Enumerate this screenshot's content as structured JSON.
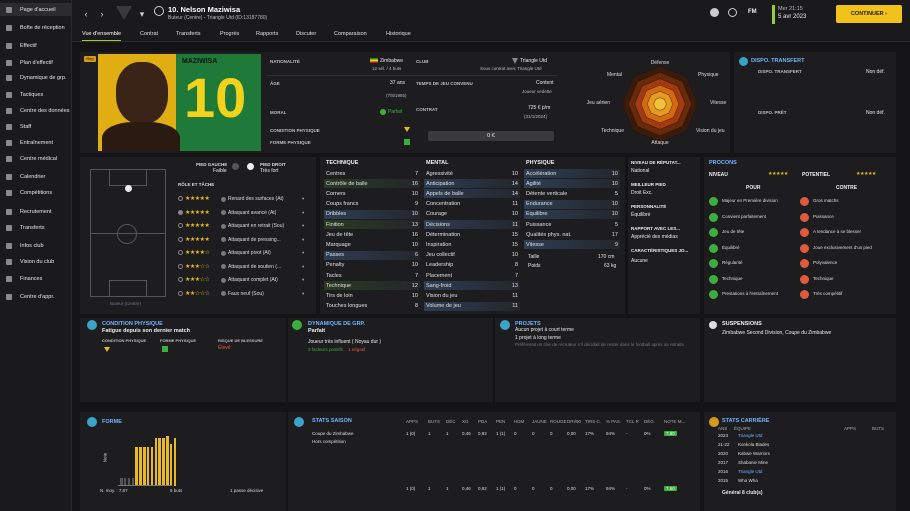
{
  "sidebar": [
    {
      "label": "Page d'accueil"
    },
    {
      "label": "Boîte de réception"
    },
    {
      "label": "Effectif"
    },
    {
      "label": "Plan d'effectif"
    },
    {
      "label": "Dynamique de grp."
    },
    {
      "label": "Tactiques"
    },
    {
      "label": "Centre des données"
    },
    {
      "label": "Staff"
    },
    {
      "label": "Entraînement"
    },
    {
      "label": "Centre médical"
    },
    {
      "label": "Calendrier"
    },
    {
      "label": "Compétitions"
    },
    {
      "label": "Recrutement"
    },
    {
      "label": "Transferts"
    },
    {
      "label": "Infos club"
    },
    {
      "label": "Vision du club"
    },
    {
      "label": "Finances"
    },
    {
      "label": "Centre d'appr."
    }
  ],
  "header": {
    "player": "10. Nelson Maziwisa",
    "subtitle": "Buteur (Centre) - Triangle Utd (ID:13187780)",
    "time": "Mer 21:15",
    "date": "5 avr 2023",
    "continue": "CONTINUER",
    "fm": "FM"
  },
  "tabs": [
    "Vue d'ensemble",
    "Contrat",
    "Transferts",
    "Progrès",
    "Rapports",
    "Discuter",
    "Comparaison",
    "Historique"
  ],
  "profile": {
    "shirt_name": "MAZIWISA",
    "shirt_number": "10",
    "badge": "Rep",
    "nationality_label": "NATIONALITÉ",
    "nationality": "Zimbabwe",
    "caps": "12 sél. / 4 buts",
    "club_label": "CLUB",
    "club": "Triangle Utd",
    "club_contract": "Sous contrat avec Triangle Utd",
    "age_label": "ÂGE",
    "age": "37 ans",
    "dob": "(7/8/1985)",
    "playtime_label": "TEMPS DE JEU CONVENU",
    "playtime": "Content",
    "playtime_role": "Joueur vedette",
    "contract_label": "CONTRAT",
    "wage": "725 € p/m",
    "contract_end": "(31/1/2024)",
    "morale_label": "MORAL",
    "morale": "Parfait",
    "condition_label": "CONDITION PHYSIQUE",
    "form_label": "FORME PHYSIQUE",
    "value": "0 €"
  },
  "radar": {
    "labels": [
      "Défense",
      "Physique",
      "Vitesse",
      "Vision du jeu",
      "Attaque",
      "Technique",
      "Jeu aérien",
      "Mental"
    ]
  },
  "transfer": {
    "title": "DISPO. TRANSFERT",
    "r1_label": "DISPO. TRANSFERT",
    "r1": "Non déf.",
    "r2_label": "DISPO. PRÊT",
    "r2": "Non déf."
  },
  "positions": {
    "foot_left_label": "PIED GAUCHE",
    "foot_left": "Faible",
    "foot_right_label": "PIED DROIT",
    "foot_right": "Très fort",
    "pitch_caption": "Buteur (Centre)",
    "role_title": "RÔLE ET TÂCHE",
    "roles": [
      {
        "name": "Renard des surfaces (At)",
        "stars": "★★★★★"
      },
      {
        "name": "Attaquant avancé (At)",
        "stars": "★★★★★"
      },
      {
        "name": "Attaquant en retrait (Sou)",
        "stars": "★★★★★"
      },
      {
        "name": "Attaquant de pressing...",
        "stars": "★★★★★"
      },
      {
        "name": "Attaquant pivot (At)",
        "stars": "★★★★☆"
      },
      {
        "name": "Attaquant de soutien (...",
        "stars": "★★★☆☆"
      },
      {
        "name": "Attaquant complet (At)",
        "stars": "★★★☆☆"
      },
      {
        "name": "Faux neuf (Sou)",
        "stars": "★★☆☆☆"
      }
    ]
  },
  "technique": {
    "title": "TECHNIQUE",
    "rows": [
      [
        "Centres",
        "7",
        ""
      ],
      [
        "Contrôle de balle",
        "16",
        "gr"
      ],
      [
        "Corners",
        "10",
        ""
      ],
      [
        "Coups francs",
        "9",
        ""
      ],
      [
        "Dribbles",
        "10",
        "hl"
      ],
      [
        "Finition",
        "13",
        "gr"
      ],
      [
        "Jeu de tête",
        "16",
        ""
      ],
      [
        "Marquage",
        "10",
        ""
      ],
      [
        "Passes",
        "6",
        "hl"
      ],
      [
        "Penalty",
        "10",
        ""
      ],
      [
        "Tacles",
        "7",
        ""
      ],
      [
        "Technique",
        "12",
        "gr"
      ],
      [
        "Tirs de loin",
        "10",
        ""
      ],
      [
        "Touches longues",
        "8",
        ""
      ]
    ]
  },
  "mental": {
    "title": "MENTAL",
    "rows": [
      [
        "Agressivité",
        "10",
        ""
      ],
      [
        "Anticipation",
        "14",
        "hl"
      ],
      [
        "Appels de balle",
        "14",
        "hl"
      ],
      [
        "Concentration",
        "11",
        ""
      ],
      [
        "Courage",
        "10",
        ""
      ],
      [
        "Décisions",
        "11",
        "hl"
      ],
      [
        "Détermination",
        "15",
        ""
      ],
      [
        "Inspiration",
        "15",
        ""
      ],
      [
        "Jeu collectif",
        "10",
        ""
      ],
      [
        "Leadership",
        "8",
        ""
      ],
      [
        "Placement",
        "7",
        ""
      ],
      [
        "Sang-froid",
        "13",
        "hl"
      ],
      [
        "Vision du jeu",
        "11",
        ""
      ],
      [
        "Volume de jeu",
        "11",
        "hl"
      ]
    ]
  },
  "physique": {
    "title": "PHYSIQUE",
    "rows": [
      [
        "Accélération",
        "10",
        "hl"
      ],
      [
        "Agilité",
        "10",
        "hl"
      ],
      [
        "Détente verticale",
        "5",
        ""
      ],
      [
        "Endurance",
        "10",
        "hl"
      ],
      [
        "Equilibre",
        "10",
        "hl"
      ],
      [
        "Puissance",
        "5",
        ""
      ],
      [
        "Qualités phys. nat.",
        "17",
        ""
      ],
      [
        "Vitesse",
        "9",
        "hl"
      ]
    ],
    "height_label": "Taille",
    "height": "170 cm",
    "weight_label": "Poids",
    "weight": "63 kg"
  },
  "info": {
    "rep_label": "NIVEAU DE RÉPUTAT...",
    "rep": "National",
    "foot_label": "MEILLEUR PIED",
    "foot": "Droit Exc.",
    "pers_label": "PERSONNALITÉ",
    "pers": "Équilibré",
    "media_label": "RAPPORT AVEC LES...",
    "media": "Apprécié des médias",
    "char_label": "CARACTÉRISTIQUES JO...",
    "char": "Aucune"
  },
  "procons": {
    "title": "PROCONS",
    "level": "NIVEAU",
    "potential": "POTENTIEL",
    "pour": "POUR",
    "contre": "CONTRE",
    "level_stars": "★★★★★",
    "pot_stars": "★★★★★",
    "pros": [
      "Majeur en Première division",
      "Convient parfaitement",
      "Jeu de tête",
      "Équilibré",
      "Régularité",
      "Technique",
      "Prestations à l'entraînement"
    ],
    "cons": [
      "Gros matchs",
      "Puissance",
      "A tendance à se blesser",
      "Joue exclusivement d'un pied",
      "Polyvalence",
      "Technique",
      "Très compétitif"
    ]
  },
  "condition": {
    "title": "CONDITION PHYSIQUE",
    "text": "Fatigue depuis son dernier match",
    "c1": "CONDITION PHYSIQUE",
    "c2": "FORME PHYSIQUE",
    "c3": "RISQUE DE BLESSURE",
    "risk": "Élevé"
  },
  "dynamics": {
    "title": "DYNAMIQUE DE GRP.",
    "state": "Parfait",
    "role": "Joueur très influent ( Noyau dur )",
    "pos": "3 facteurs positifs",
    "neg": "1 négatif"
  },
  "projects": {
    "title": "PROJETS",
    "p1": "Aucun projet à court terme",
    "p2": "1 projet à long terme",
    "p3": "Préférerait un rôle de recruteur s'il décidait de rester dans le football après sa retraite"
  },
  "susp": {
    "title": "SUSPENSIONS",
    "text": "Zimbabwe Second Division, Coupe du Zimbabwe"
  },
  "form": {
    "title": "FORME",
    "ylabel": "Note",
    "avg": "N. moy. : 7,67",
    "goals": "5 buts",
    "assist": "1 passe décisive",
    "bars": [
      0.15,
      0.15,
      0.15,
      0.15,
      0.7,
      0.7,
      0.7,
      0.7,
      0.7,
      0.85,
      0.85,
      0.85,
      0.9,
      0.75,
      0.85
    ]
  },
  "season": {
    "title": "STATS SAISON",
    "cols": [
      "APPS",
      "BUTS",
      "DÉC",
      "XG",
      "PDA",
      "PEN",
      "HDM",
      "JAUNE",
      "ROUGE",
      "DRI/90",
      "TIRS C.",
      "% PAS.",
      "TCL R",
      "DÉG.",
      "NOTE M..."
    ],
    "rows": [
      {
        "name": "Coupe du Zimbabwe",
        "vals": [
          "1 (0)",
          "1",
          "1",
          "0,46",
          "0,92",
          "1 (1)",
          "0",
          "0",
          "0",
          "0,00",
          "17%",
          "94%",
          "-",
          "0%",
          "7,60"
        ]
      },
      {
        "name": "Hors compétition",
        "vals": [
          "",
          "",
          "",
          "",
          "",
          "",
          "",
          "",
          "",
          "",
          "",
          "",
          "",
          "",
          ""
        ]
      },
      {
        "name": "",
        "vals": [
          "1 (0)",
          "1",
          "1",
          "0,46",
          "0,92",
          "1 (1)",
          "0",
          "0",
          "0",
          "0,00",
          "17%",
          "94%",
          "-",
          "0%",
          "7,60"
        ]
      }
    ]
  },
  "career": {
    "title": "STATS CARRIÈRE",
    "cols": [
      "ANS",
      "ÉQUIPE",
      "APPS",
      "BUTS"
    ],
    "rows": [
      [
        "2023",
        "Triangle Utd"
      ],
      [
        "21-22",
        "Konkola Blades"
      ],
      [
        "2020",
        "Kabwe Warriors"
      ],
      [
        "2017",
        "Shabanie Mine"
      ],
      [
        "2016",
        "Triangle Utd"
      ],
      [
        "2015",
        "Wha Wha"
      ]
    ],
    "total": "Général 8 club(s)"
  },
  "colors": {
    "accent": "#9acd32",
    "gold": "#e8b923",
    "blue": "#6fb3ff",
    "red": "#e05a3a",
    "green": "#3cae3c"
  }
}
